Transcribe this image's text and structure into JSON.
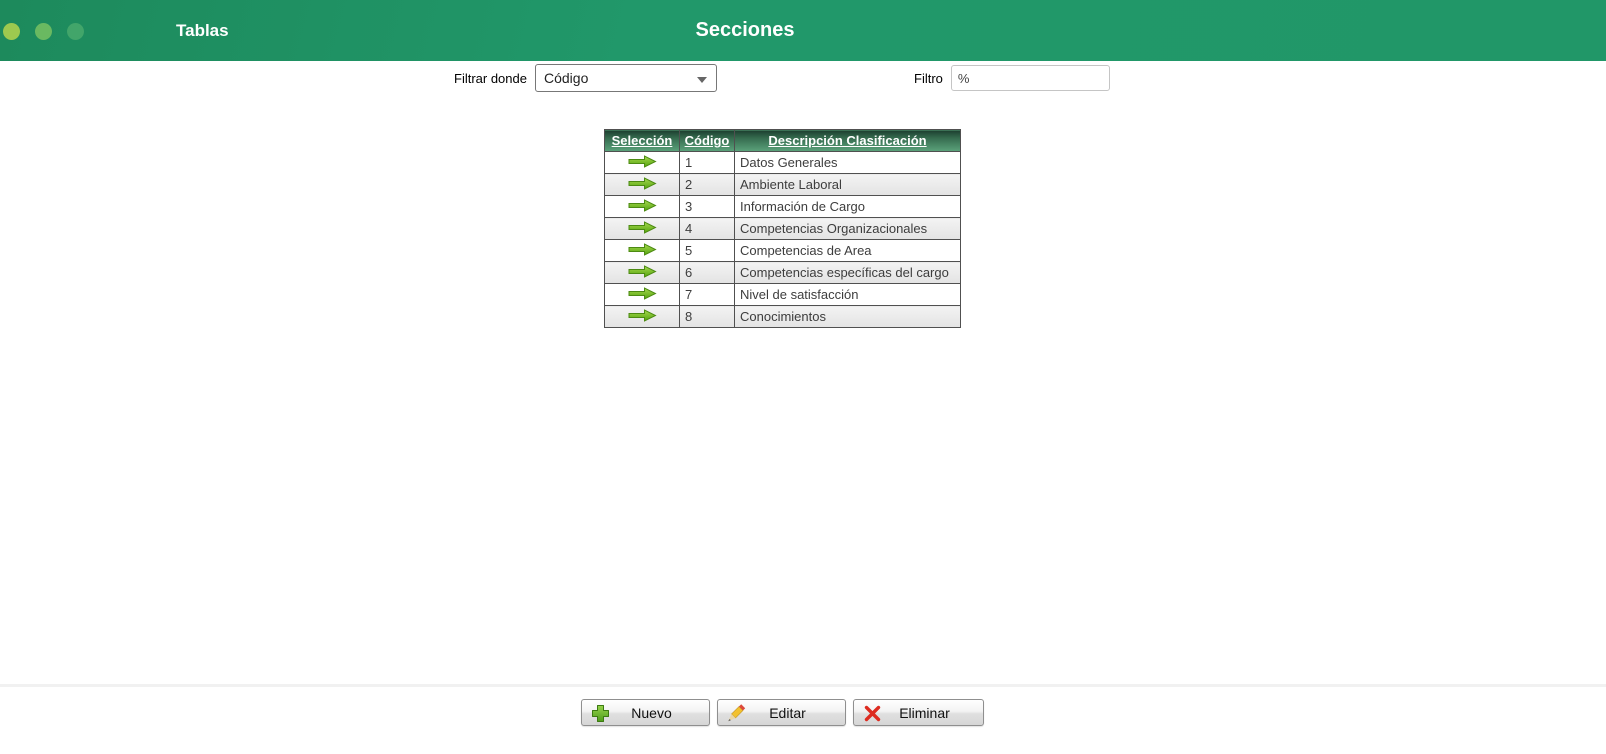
{
  "window": {
    "app_title": "Tablas",
    "page_title": "Secciones"
  },
  "theme": {
    "header_green": "#21986a",
    "table_header_green": "#356a4e",
    "accent_green": "#6cb52d",
    "delete_red": "#dd2b20"
  },
  "filter": {
    "where_label": "Filtrar donde",
    "where_value": "Código",
    "label": "Filtro",
    "value": "%"
  },
  "table": {
    "columns": [
      "Selección",
      "Código",
      "Descripción Clasificación"
    ],
    "rows": [
      {
        "codigo": "1",
        "descripcion": "Datos Generales"
      },
      {
        "codigo": "2",
        "descripcion": "Ambiente Laboral"
      },
      {
        "codigo": "3",
        "descripcion": "Información de Cargo"
      },
      {
        "codigo": "4",
        "descripcion": "Competencias Organizacionales"
      },
      {
        "codigo": "5",
        "descripcion": "Competencias de Area"
      },
      {
        "codigo": "6",
        "descripcion": "Competencias específicas del cargo"
      },
      {
        "codigo": "7",
        "descripcion": "Nivel de satisfacción"
      },
      {
        "codigo": "8",
        "descripcion": "Conocimientos"
      }
    ]
  },
  "actions": {
    "new": "Nuevo",
    "edit": "Editar",
    "delete": "Eliminar"
  }
}
